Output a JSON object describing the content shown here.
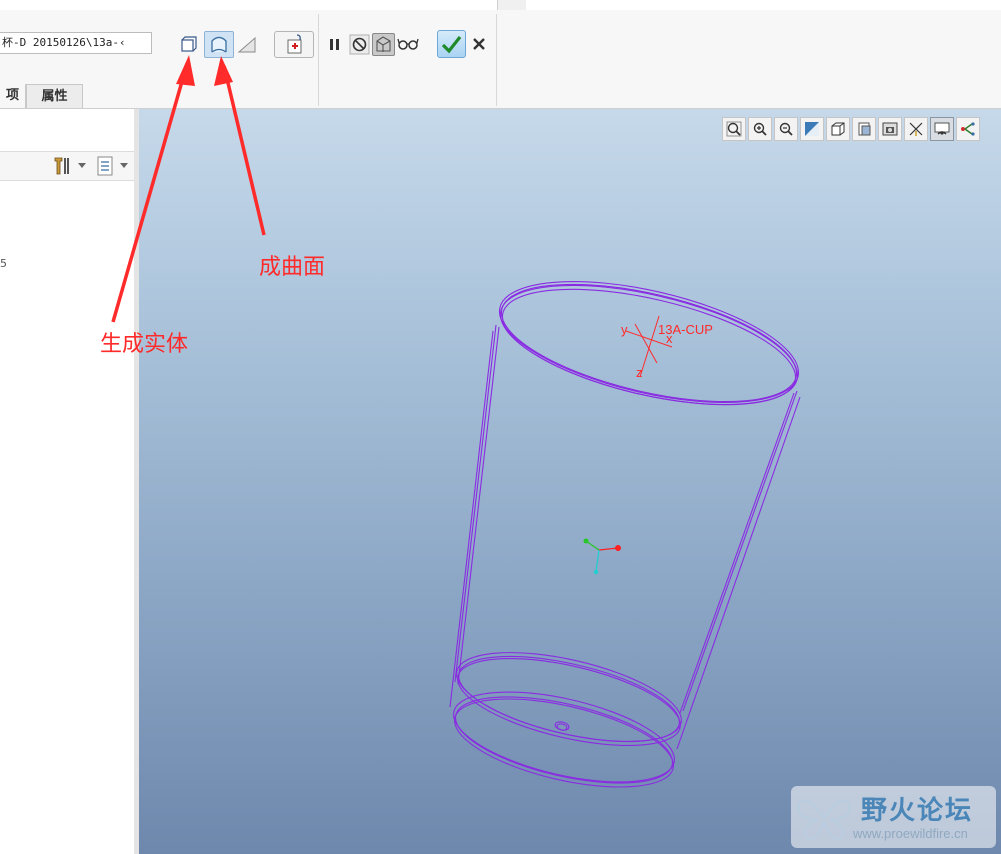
{
  "toolbar": {
    "file_path": "杯-D  20150126\\13a-‹",
    "buttons": [
      {
        "icon": "solid-icon"
      },
      {
        "icon": "surface-icon",
        "pressed": true
      },
      {
        "icon": "thin-icon"
      },
      {
        "icon": "taper-insert-icon"
      },
      {
        "icon": "pause-icon"
      },
      {
        "icon": "no-preview-icon"
      },
      {
        "icon": "attached-preview-icon",
        "pressed": true
      },
      {
        "icon": "glasses-preview-icon"
      },
      {
        "icon": "confirm-check-icon"
      },
      {
        "icon": "cancel-x-icon"
      }
    ],
    "tabs": [
      {
        "label": "项"
      },
      {
        "label": "属性"
      }
    ]
  },
  "left_panel": {
    "tree_text": "5"
  },
  "viewport": {
    "coordinate_system": {
      "name": "13A-CUP",
      "axis_x": "x",
      "axis_y": "y",
      "axis_z": "z"
    },
    "view_toolbar_icons": [
      "refit-icon",
      "zoom-in-icon",
      "zoom-out-icon",
      "repaint-icon",
      "saved-view-icon",
      "display-style-icon",
      "view-manager-icon",
      "datum-display-icon",
      "spin-center-icon",
      "annotation-display-icon"
    ]
  },
  "annotations": {
    "surface_label": "成曲面",
    "solid_label": "生成实体",
    "color": "#ff2a2a"
  },
  "watermark": {
    "title": "野火论坛",
    "url": "www.proewildfire.cn"
  },
  "colors": {
    "wireframe": "#8a2be2",
    "csys": "#ff2a2a",
    "accent": "#6ea8d8"
  }
}
